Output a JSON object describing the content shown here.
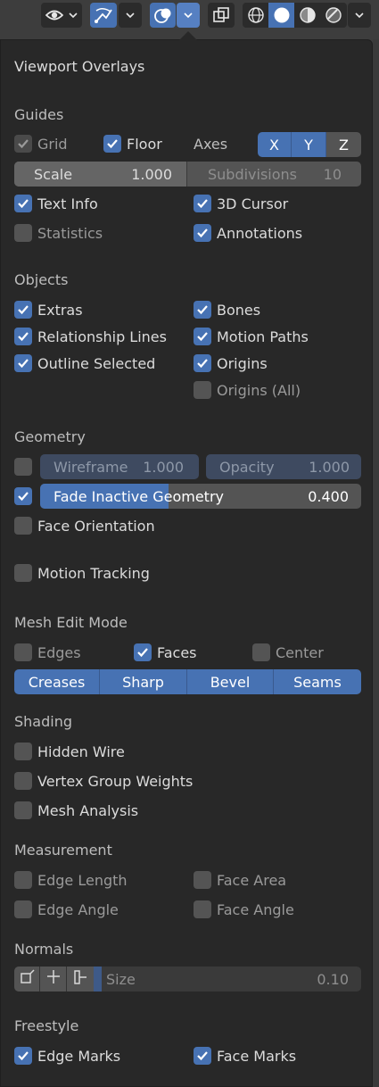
{
  "panel": {
    "title": "Viewport Overlays"
  },
  "toolbar": {
    "icons": [
      "eye-icon",
      "chevron-down-icon",
      "gizmo-icon",
      "chevron-down-icon",
      "overlays-icon",
      "chevron-down-icon",
      "xray-icon",
      "wireframe-shading-icon",
      "solid-shading-icon",
      "material-shading-icon",
      "rendered-shading-icon",
      "chevron-down-icon"
    ]
  },
  "guides": {
    "heading": "Guides",
    "grid": "Grid",
    "floor": "Floor",
    "axes_label": "Axes",
    "axes": [
      "X",
      "Y",
      "Z"
    ],
    "scale_label": "Scale",
    "scale_value": "1.000",
    "subdivisions_label": "Subdivisions",
    "subdivisions_value": "10",
    "text_info": "Text Info",
    "cursor": "3D Cursor",
    "statistics": "Statistics",
    "annotations": "Annotations"
  },
  "objects": {
    "heading": "Objects",
    "extras": "Extras",
    "bones": "Bones",
    "relationship_lines": "Relationship Lines",
    "motion_paths": "Motion Paths",
    "outline_selected": "Outline Selected",
    "origins": "Origins",
    "origins_all": "Origins (All)"
  },
  "geometry": {
    "heading": "Geometry",
    "wireframe_label": "Wireframe",
    "wireframe_value": "1.000",
    "opacity_label": "Opacity",
    "opacity_value": "1.000",
    "fade_label": "Fade Inactive Geometry",
    "fade_value": "0.400",
    "fade_fraction": 0.4,
    "face_orientation": "Face Orientation",
    "motion_tracking": "Motion Tracking"
  },
  "mesh_edit": {
    "heading": "Mesh Edit Mode",
    "edges": "Edges",
    "faces": "Faces",
    "center": "Center",
    "buttons": [
      "Creases",
      "Sharp",
      "Bevel",
      "Seams"
    ]
  },
  "shading": {
    "heading": "Shading",
    "hidden_wire": "Hidden Wire",
    "vertex_group_weights": "Vertex Group Weights",
    "mesh_analysis": "Mesh Analysis"
  },
  "measurement": {
    "heading": "Measurement",
    "edge_length": "Edge Length",
    "face_area": "Face Area",
    "edge_angle": "Edge Angle",
    "face_angle": "Face Angle"
  },
  "normals": {
    "heading": "Normals",
    "size_label": "Size",
    "size_value": "0.10"
  },
  "freestyle": {
    "heading": "Freestyle",
    "edge_marks": "Edge Marks",
    "face_marks": "Face Marks"
  },
  "colors": {
    "accent": "#4772b3",
    "panel": "#282828",
    "field": "#545454"
  }
}
